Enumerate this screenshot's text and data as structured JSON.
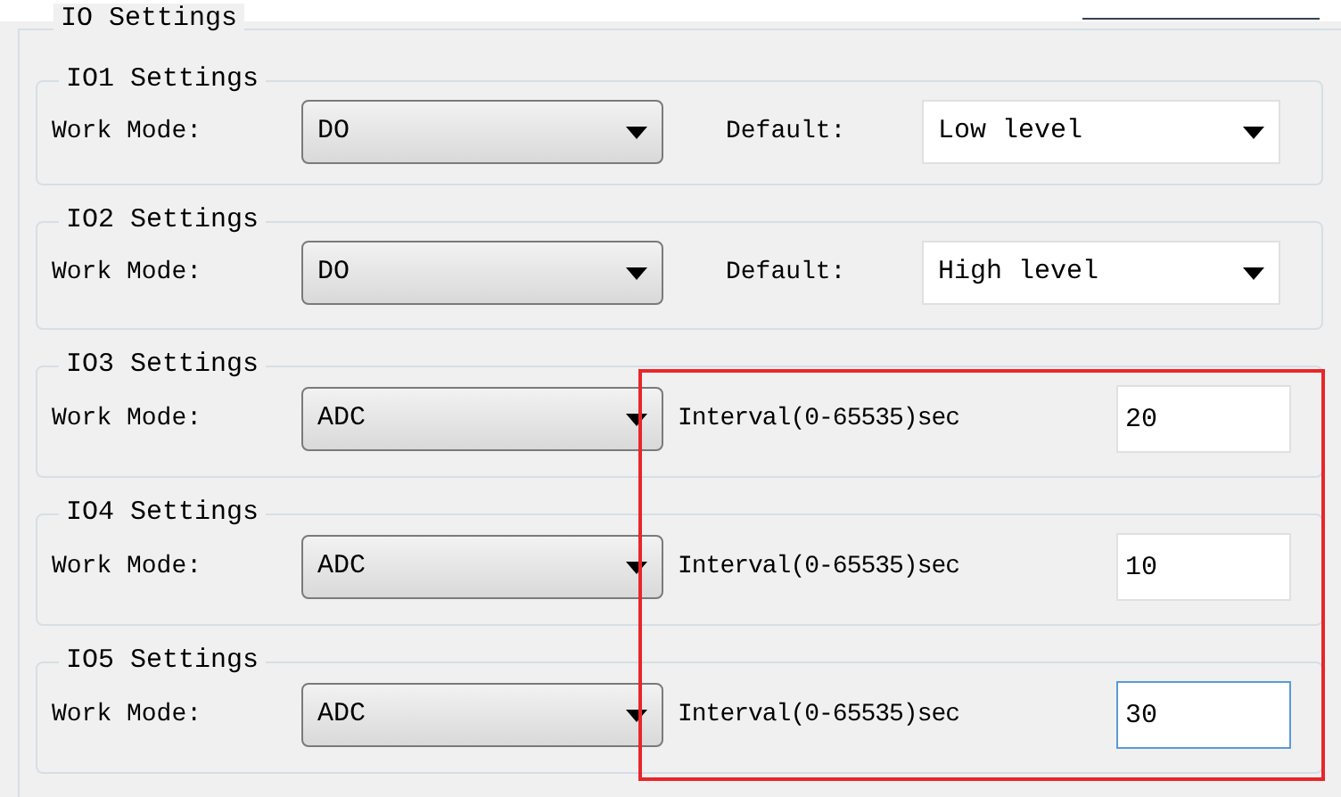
{
  "panel": {
    "title": "IO Settings"
  },
  "groups": [
    {
      "title": "IO1 Settings",
      "mode_label": "Work Mode:",
      "mode": "DO",
      "kind": "default",
      "option_label": "Default:",
      "option_value": "Low level"
    },
    {
      "title": "IO2 Settings",
      "mode_label": "Work Mode:",
      "mode": "DO",
      "kind": "default",
      "option_label": "Default:",
      "option_value": "High level"
    },
    {
      "title": "IO3 Settings",
      "mode_label": "Work Mode:",
      "mode": "ADC",
      "kind": "interval",
      "option_label": "Interval(0-65535)sec",
      "option_value": "20",
      "focused": false
    },
    {
      "title": "IO4 Settings",
      "mode_label": "Work Mode:",
      "mode": "ADC",
      "kind": "interval",
      "option_label": "Interval(0-65535)sec",
      "option_value": "10",
      "focused": false
    },
    {
      "title": "IO5 Settings",
      "mode_label": "Work Mode:",
      "mode": "ADC",
      "kind": "interval",
      "option_label": "Interval(0-65535)sec",
      "option_value": "30",
      "focused": true
    }
  ]
}
